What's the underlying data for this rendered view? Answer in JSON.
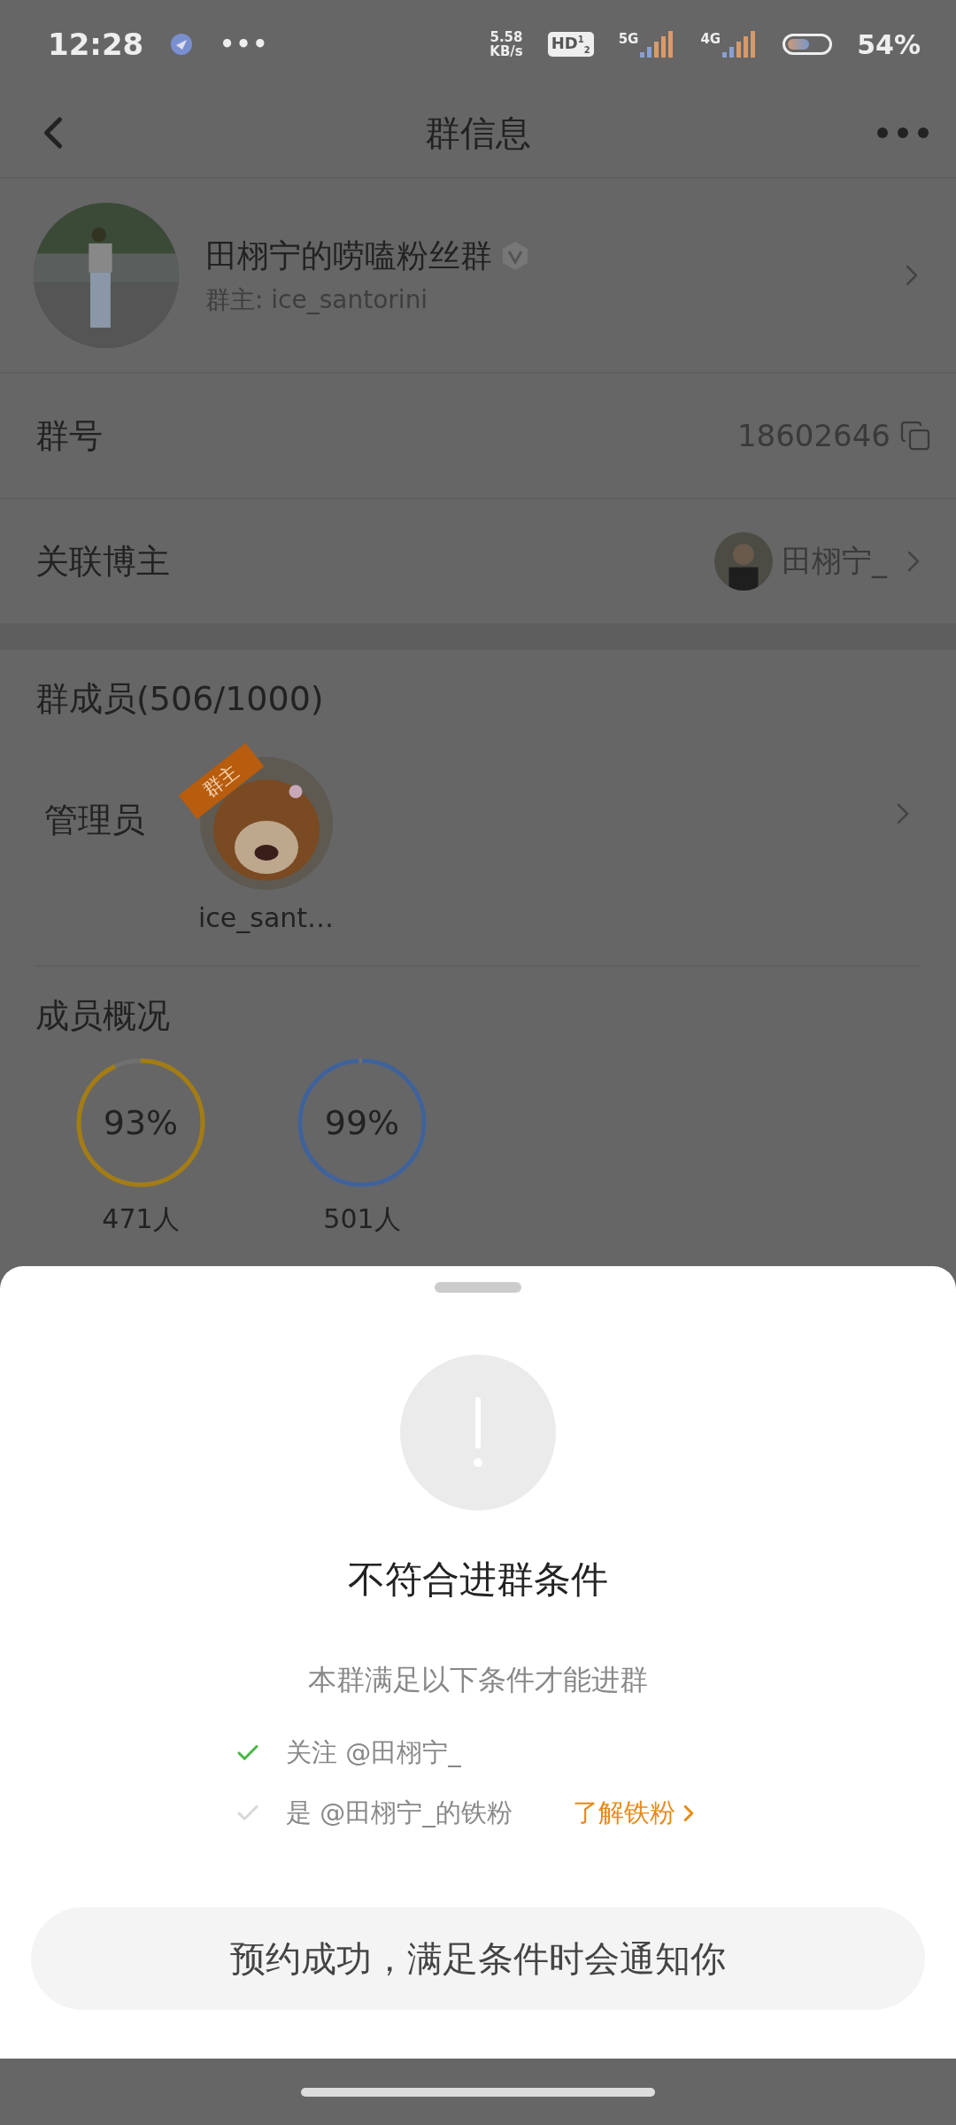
{
  "status_bar": {
    "time": "12:28",
    "more": "•••",
    "speed": [
      "5.58",
      "KB/s"
    ],
    "hd": "HD$^{1}$$_{2}$",
    "networks": [
      "5G",
      "4G"
    ],
    "battery": "54%"
  },
  "header": {
    "title": "群信息"
  },
  "group": {
    "name": "田栩宁的唠嗑粉丝群",
    "owner": "群主: ice_santorini"
  },
  "rows": [
    {
      "label": "群号",
      "value": "18602646",
      "kind": "copy"
    },
    {
      "label": "关联博主",
      "value": "田栩宁_",
      "kind": "blogger"
    }
  ],
  "members": {
    "title": "群成员(506/1000)",
    "admin_label": "管理员",
    "admins": [
      {
        "name": "ice_sant…",
        "badge": "群主"
      }
    ]
  },
  "overview": {
    "title": "成员概况",
    "stats": [
      {
        "reading": "93%",
        "level": 0.93,
        "count": "471人",
        "color": "#a47c14"
      },
      {
        "reading": "99%",
        "level": 0.99,
        "count": "501人",
        "color": "#40629a"
      }
    ]
  },
  "sheet": {
    "title": "不符合进群条件",
    "subtitle": "本群满足以下条件才能进群",
    "conditions": [
      {
        "text": "关注 @田栩宁_",
        "checked": true
      },
      {
        "text": "是 @田栩宁_的铁粉",
        "checked": false,
        "link": "了解铁粉"
      }
    ],
    "button": "预约成功，满足条件时会通知你"
  }
}
